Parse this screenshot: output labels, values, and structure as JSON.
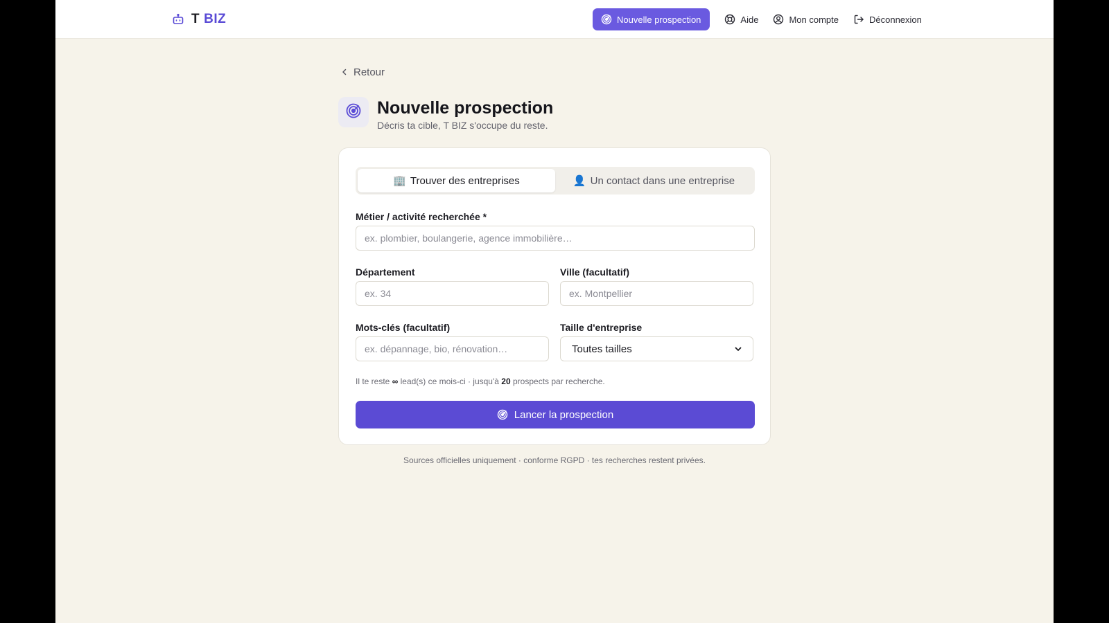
{
  "brand": {
    "letter": "T",
    "name": "BIZ"
  },
  "nav": {
    "primary_label": "Nouvelle prospection",
    "help_label": "Aide",
    "account_label": "Mon compte",
    "logout_label": "Déconnexion"
  },
  "back_label": "Retour",
  "page": {
    "title": "Nouvelle prospection",
    "subtitle": "Décris ta cible, T BIZ s'occupe du reste."
  },
  "tabs": [
    {
      "emoji": "🏢",
      "label": "Trouver des entreprises",
      "active": true
    },
    {
      "emoji": "👤",
      "label": "Un contact dans une entreprise",
      "active": false
    }
  ],
  "form": {
    "activity": {
      "label": "Métier / activité recherchée *",
      "placeholder": "ex. plombier, boulangerie, agence immobilière…",
      "value": ""
    },
    "department": {
      "label": "Département",
      "placeholder": "ex. 34",
      "value": ""
    },
    "city": {
      "label": "Ville (facultatif)",
      "placeholder": "ex. Montpellier",
      "value": ""
    },
    "keywords": {
      "label": "Mots-clés (facultatif)",
      "placeholder": "ex. dépannage, bio, rénovation…",
      "value": ""
    },
    "company_size": {
      "label": "Taille d'entreprise",
      "selected": "Toutes tailles"
    }
  },
  "quota": {
    "prefix": "Il te reste",
    "remaining": "∞",
    "middle": "lead(s) ce mois-ci · jusqu'à",
    "max_per_search": "20",
    "suffix": "prospects par recherche."
  },
  "submit_label": "Lancer la prospection",
  "footnote": "Sources officielles uniquement · conforme RGPD · tes recherches restent privées.",
  "colors": {
    "accent": "#5b4bd4",
    "accent_light": "#6a5ae0",
    "background": "#f6f3ea"
  }
}
